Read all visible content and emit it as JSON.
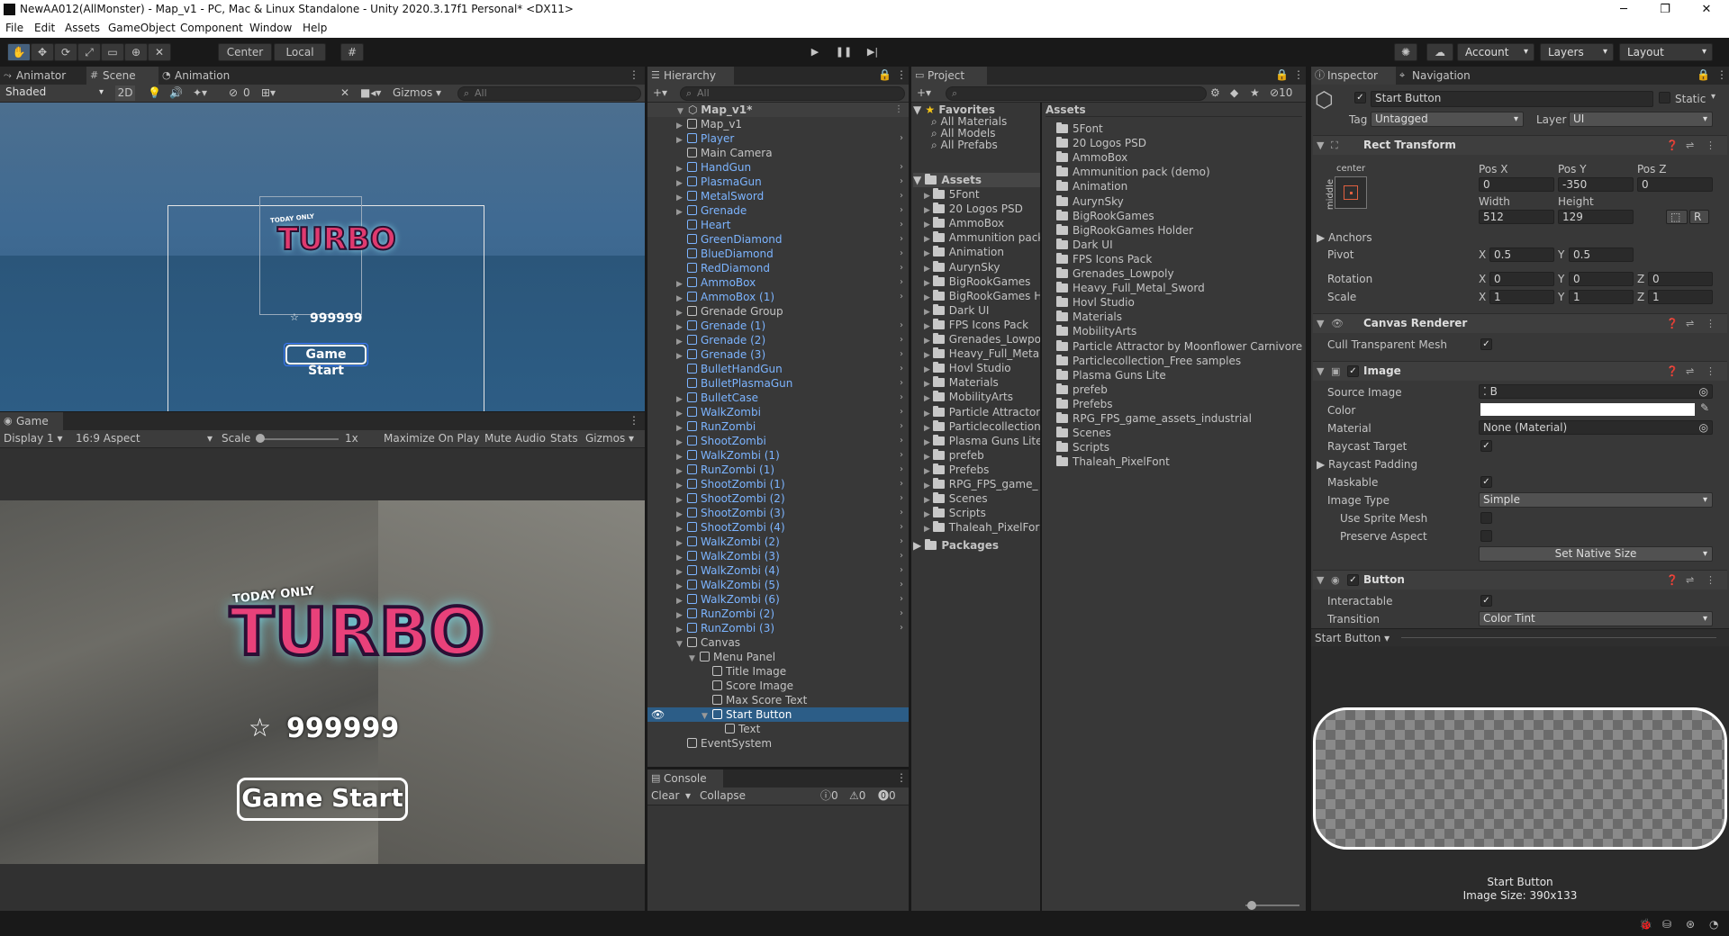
{
  "window": {
    "title": "NewAA012(AllMonster) - Map_v1 - PC, Mac & Linux Standalone - Unity 2020.3.17f1 Personal* <DX11>",
    "minimize": "─",
    "maximize": "❐",
    "close": "✕"
  },
  "menu": [
    "File",
    "Edit",
    "Assets",
    "GameObject",
    "Component",
    "Window",
    "Help"
  ],
  "toolbar": {
    "center": "Center",
    "local": "Local",
    "account": "Account",
    "layers": "Layers",
    "layout": "Layout"
  },
  "scene_tabs": {
    "animator": "Animator",
    "scene": "Scene",
    "animation": "Animation"
  },
  "scene_controls": {
    "shading": "Shaded",
    "mode2d": "2D",
    "hidden_count": "0",
    "gizmos": "Gizmos",
    "search": "All"
  },
  "scene_view": {
    "today_only": "TODAY ONLY",
    "turbo": "TURBO",
    "score": "999999",
    "button": "Game Start"
  },
  "game_tab": {
    "label": "Game",
    "display": "Display 1",
    "aspect": "16:9 Aspect",
    "scale_label": "Scale",
    "scale_value": "1x",
    "maximize": "Maximize On Play",
    "mute": "Mute Audio",
    "stats": "Stats",
    "gizmos": "Gizmos"
  },
  "game_view": {
    "today_only": "TODAY ONLY",
    "turbo": "TURBO",
    "score": "999999",
    "button": "Game Start"
  },
  "hierarchy": {
    "tab": "Hierarchy",
    "search": "All",
    "scene": "Map_v1*",
    "items": [
      {
        "label": "Map_v1",
        "indent": 1,
        "blue": false,
        "fold": "▶",
        "arrow": false
      },
      {
        "label": "Player",
        "indent": 1,
        "blue": true,
        "fold": "▶",
        "arrow": true
      },
      {
        "label": "Main Camera",
        "indent": 1,
        "blue": false,
        "fold": "",
        "arrow": false
      },
      {
        "label": "HandGun",
        "indent": 1,
        "blue": true,
        "fold": "▶",
        "arrow": true
      },
      {
        "label": "PlasmaGun",
        "indent": 1,
        "blue": true,
        "fold": "▶",
        "arrow": true
      },
      {
        "label": "MetalSword",
        "indent": 1,
        "blue": true,
        "fold": "▶",
        "arrow": true
      },
      {
        "label": "Grenade",
        "indent": 1,
        "blue": true,
        "fold": "▶",
        "arrow": true
      },
      {
        "label": "Heart",
        "indent": 1,
        "blue": true,
        "fold": "",
        "arrow": true
      },
      {
        "label": "GreenDiamond",
        "indent": 1,
        "blue": true,
        "fold": "",
        "arrow": true
      },
      {
        "label": "BlueDiamond",
        "indent": 1,
        "blue": true,
        "fold": "",
        "arrow": true
      },
      {
        "label": "RedDiamond",
        "indent": 1,
        "blue": true,
        "fold": "",
        "arrow": true
      },
      {
        "label": "AmmoBox",
        "indent": 1,
        "blue": true,
        "fold": "▶",
        "arrow": true
      },
      {
        "label": "AmmoBox (1)",
        "indent": 1,
        "blue": true,
        "fold": "▶",
        "arrow": true
      },
      {
        "label": "Grenade Group",
        "indent": 1,
        "blue": false,
        "fold": "▶",
        "arrow": false
      },
      {
        "label": "Grenade (1)",
        "indent": 1,
        "blue": true,
        "fold": "▶",
        "arrow": true
      },
      {
        "label": "Grenade (2)",
        "indent": 1,
        "blue": true,
        "fold": "▶",
        "arrow": true
      },
      {
        "label": "Grenade (3)",
        "indent": 1,
        "blue": true,
        "fold": "▶",
        "arrow": true
      },
      {
        "label": "BulletHandGun",
        "indent": 1,
        "blue": true,
        "fold": "",
        "arrow": true
      },
      {
        "label": "BulletPlasmaGun",
        "indent": 1,
        "blue": true,
        "fold": "",
        "arrow": true
      },
      {
        "label": "BulletCase",
        "indent": 1,
        "blue": true,
        "fold": "▶",
        "arrow": true
      },
      {
        "label": "WalkZombi",
        "indent": 1,
        "blue": true,
        "fold": "▶",
        "arrow": true
      },
      {
        "label": "RunZombi",
        "indent": 1,
        "blue": true,
        "fold": "▶",
        "arrow": true
      },
      {
        "label": "ShootZombi",
        "indent": 1,
        "blue": true,
        "fold": "▶",
        "arrow": true
      },
      {
        "label": "WalkZombi (1)",
        "indent": 1,
        "blue": true,
        "fold": "▶",
        "arrow": true
      },
      {
        "label": "RunZombi (1)",
        "indent": 1,
        "blue": true,
        "fold": "▶",
        "arrow": true
      },
      {
        "label": "ShootZombi (1)",
        "indent": 1,
        "blue": true,
        "fold": "▶",
        "arrow": true
      },
      {
        "label": "ShootZombi (2)",
        "indent": 1,
        "blue": true,
        "fold": "▶",
        "arrow": true
      },
      {
        "label": "ShootZombi (3)",
        "indent": 1,
        "blue": true,
        "fold": "▶",
        "arrow": true
      },
      {
        "label": "ShootZombi (4)",
        "indent": 1,
        "blue": true,
        "fold": "▶",
        "arrow": true
      },
      {
        "label": "WalkZombi (2)",
        "indent": 1,
        "blue": true,
        "fold": "▶",
        "arrow": true
      },
      {
        "label": "WalkZombi (3)",
        "indent": 1,
        "blue": true,
        "fold": "▶",
        "arrow": true
      },
      {
        "label": "WalkZombi (4)",
        "indent": 1,
        "blue": true,
        "fold": "▶",
        "arrow": true
      },
      {
        "label": "WalkZombi (5)",
        "indent": 1,
        "blue": true,
        "fold": "▶",
        "arrow": true
      },
      {
        "label": "WalkZombi (6)",
        "indent": 1,
        "blue": true,
        "fold": "▶",
        "arrow": true
      },
      {
        "label": "RunZombi (2)",
        "indent": 1,
        "blue": true,
        "fold": "▶",
        "arrow": true
      },
      {
        "label": "RunZombi (3)",
        "indent": 1,
        "blue": true,
        "fold": "▶",
        "arrow": true
      },
      {
        "label": "Canvas",
        "indent": 1,
        "blue": false,
        "fold": "▼",
        "arrow": false
      },
      {
        "label": "Menu Panel",
        "indent": 2,
        "blue": false,
        "fold": "▼",
        "arrow": false
      },
      {
        "label": "Title Image",
        "indent": 3,
        "blue": false,
        "fold": "",
        "arrow": false
      },
      {
        "label": "Score Image",
        "indent": 3,
        "blue": false,
        "fold": "",
        "arrow": false
      },
      {
        "label": "Max Score Text",
        "indent": 3,
        "blue": false,
        "fold": "",
        "arrow": false
      },
      {
        "label": "Start Button",
        "indent": 3,
        "blue": false,
        "fold": "▼",
        "arrow": false,
        "selected": true
      },
      {
        "label": "Text",
        "indent": 4,
        "blue": false,
        "fold": "",
        "arrow": false
      },
      {
        "label": "EventSystem",
        "indent": 1,
        "blue": false,
        "fold": "",
        "arrow": false
      }
    ]
  },
  "console": {
    "tab": "Console",
    "clear": "Clear",
    "collapse": "Collapse",
    "info": "0",
    "warn": "0",
    "error": "0"
  },
  "project": {
    "tab": "Project",
    "hidden": "10",
    "favorites": "Favorites",
    "fav_items": [
      "All Materials",
      "All Models",
      "All Prefabs"
    ],
    "assets": "Assets",
    "tree": [
      "5Font",
      "20 Logos PSD",
      "AmmoBox",
      "Ammunition pack",
      "Animation",
      "AurynSky",
      "BigRookGames",
      "BigRookGames H",
      "Dark UI",
      "FPS Icons Pack",
      "Grenades_Lowpo",
      "Heavy_Full_Meta",
      "Hovl Studio",
      "Materials",
      "MobilityArts",
      "Particle Attractor",
      "Particlecollection",
      "Plasma Guns Lite",
      "prefeb",
      "Prefebs",
      "RPG_FPS_game_",
      "Scenes",
      "Scripts",
      "Thaleah_PixelFor"
    ],
    "packages": "Packages",
    "list_header": "Assets",
    "list": [
      "5Font",
      "20 Logos PSD",
      "AmmoBox",
      "Ammunition pack (demo)",
      "Animation",
      "AurynSky",
      "BigRookGames",
      "BigRookGames Holder",
      "Dark UI",
      "FPS Icons Pack",
      "Grenades_Lowpoly",
      "Heavy_Full_Metal_Sword",
      "Hovl Studio",
      "Materials",
      "MobilityArts",
      "Particle Attractor by Moonflower Carnivore",
      "Particlecollection_Free samples",
      "Plasma Guns Lite",
      "prefeb",
      "Prefebs",
      "RPG_FPS_game_assets_industrial",
      "Scenes",
      "Scripts",
      "Thaleah_PixelFont"
    ]
  },
  "inspector": {
    "tab": "Inspector",
    "tab2": "Navigation",
    "object_name": "Start Button",
    "static": "Static",
    "tag_label": "Tag",
    "tag": "Untagged",
    "layer_label": "Layer",
    "layer": "UI",
    "rect": {
      "title": "Rect Transform",
      "anchor_h": "center",
      "anchor_v": "middle",
      "posx_l": "Pos X",
      "posy_l": "Pos Y",
      "posz_l": "Pos Z",
      "posx": "0",
      "posy": "-350",
      "posz": "0",
      "w_l": "Width",
      "h_l": "Height",
      "w": "512",
      "h": "129",
      "anchors": "Anchors",
      "pivot": "Pivot",
      "pivot_x": "0.5",
      "pivot_y": "0.5",
      "rotation": "Rotation",
      "rot_x": "0",
      "rot_y": "0",
      "rot_z": "0",
      "scale": "Scale",
      "sc_x": "1",
      "sc_y": "1",
      "sc_z": "1",
      "x": "X",
      "y": "Y",
      "z": "Z",
      "r_btn": "R"
    },
    "canvas_renderer": {
      "title": "Canvas Renderer",
      "cull": "Cull Transparent Mesh"
    },
    "image": {
      "title": "Image",
      "source_l": "Source Image",
      "source": "B",
      "color_l": "Color",
      "material_l": "Material",
      "material": "None (Material)",
      "raycast_l": "Raycast Target",
      "padding_l": "Raycast Padding",
      "maskable_l": "Maskable",
      "type_l": "Image Type",
      "type": "Simple",
      "sprite_mesh_l": "Use Sprite Mesh",
      "preserve_l": "Preserve Aspect",
      "native": "Set Native Size"
    },
    "button": {
      "title": "Button",
      "interactable_l": "Interactable",
      "transition_l": "Transition",
      "transition": "Color Tint"
    },
    "preview": {
      "header": "Start Button",
      "name": "Start Button",
      "size": "Image Size: 390x133"
    }
  },
  "colors": {
    "selection": "#2c5d87",
    "prefab_blue": "#7cb4ff",
    "panel": "#383838",
    "accent": "#46607c"
  }
}
